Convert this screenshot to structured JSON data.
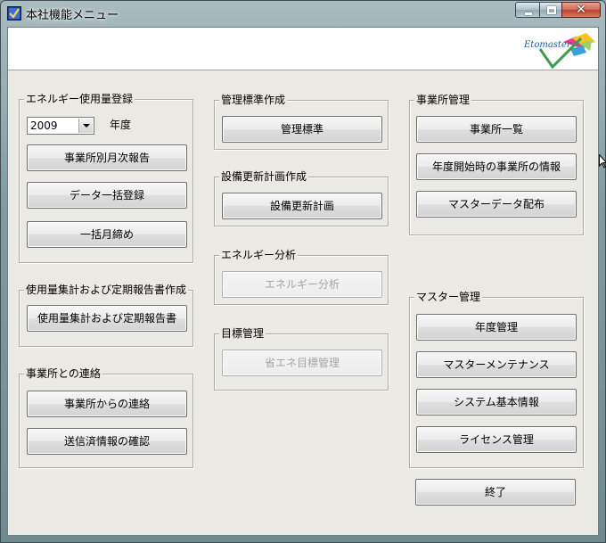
{
  "window": {
    "title": "本社機能メニュー",
    "close_glyph": "✕"
  },
  "groups": {
    "energy_usage": {
      "title": "エネルギー使用量登録",
      "year_select": {
        "value": "2009"
      },
      "year_label": "年度",
      "buttons": [
        "事業所別月次報告",
        "データ一括登録",
        "一括月締め"
      ]
    },
    "usage_report": {
      "title": "使用量集計および定期報告書作成",
      "buttons": [
        "使用量集計および定期報告書"
      ]
    },
    "office_contact": {
      "title": "事業所との連絡",
      "buttons": [
        "事業所からの連絡",
        "送信済情報の確認"
      ]
    },
    "standard": {
      "title": "管理標準作成",
      "buttons": [
        "管理標準"
      ]
    },
    "equipment": {
      "title": "設備更新計画作成",
      "buttons": [
        "設備更新計画"
      ]
    },
    "analysis": {
      "title": "エネルギー分析",
      "buttons": [
        "エネルギー分析"
      ]
    },
    "goals": {
      "title": "目標管理",
      "buttons": [
        "省エネ目標管理"
      ]
    },
    "office_mgmt": {
      "title": "事業所管理",
      "buttons": [
        "事業所一覧",
        "年度開始時の事業所の情報",
        "マスターデータ配布"
      ]
    },
    "master_mgmt": {
      "title": "マスター管理",
      "buttons": [
        "年度管理",
        "マスターメンテナンス",
        "システム基本情報",
        "ライセンス管理"
      ]
    }
  },
  "exit_button": "終了",
  "colors": {
    "window_bg": "#ebe9e3",
    "disabled_text": "#a5a5a5",
    "logo_green": "#2e8b57"
  }
}
